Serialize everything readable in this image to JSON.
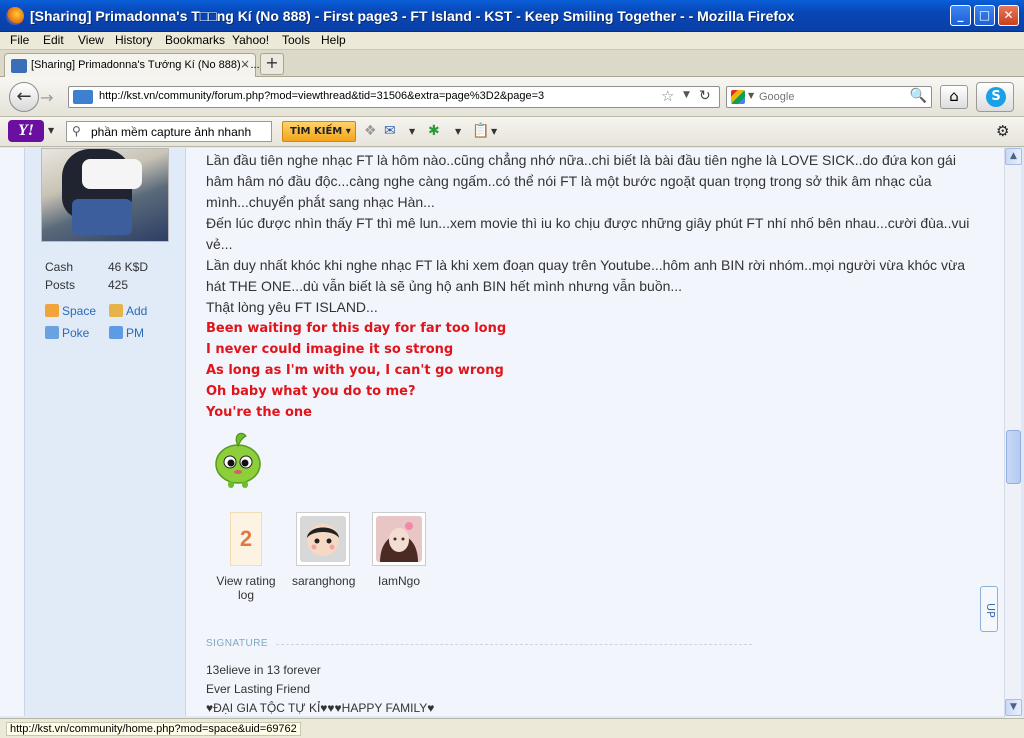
{
  "window": {
    "title": "[Sharing] Primadonna's T□□ng Kí (No 888) - First page3 - FT Island - KST - Keep Smiling Together - - Mozilla Firefox",
    "buttons": {
      "minimize": "_",
      "maximize": "□",
      "close": "✕"
    }
  },
  "menubar": {
    "items": [
      "File",
      "Edit",
      "View",
      "History",
      "Bookmarks",
      "Yahoo!",
      "Tools",
      "Help"
    ]
  },
  "tabs": [
    {
      "label": "[Sharing] Primadonna's Tướng Kí (No 888) - ...",
      "close": "×"
    }
  ],
  "new_tab": "+",
  "nav": {
    "url": "http://kst.vn/community/forum.php?mod=viewthread&tid=31506&extra=page%3D2&page=3",
    "search_placeholder": "Google"
  },
  "yahoo_toolbar": {
    "logo": "Y!",
    "search_query": "phần mềm capture ảnh nhanh",
    "search_button": "TÌM KIẾM ▾"
  },
  "profile": {
    "stats": [
      {
        "label": "Cash",
        "value": "46 K$D"
      },
      {
        "label": "Posts",
        "value": "425"
      }
    ],
    "links": {
      "space": "Space",
      "add": "Add",
      "poke": "Poke",
      "pm": "PM"
    }
  },
  "post": {
    "lines": [
      "Lần đầu tiên nghe nhạc FT là hôm nào..cũng chẳng nhớ nữa..chi biết là bài đầu tiên nghe là LOVE SICK..do đứa kon gái",
      "hâm hâm nó đầu độc...càng nghe càng ngấm..có thể nói FT là một bước ngoặt quan trọng trong sở thik âm nhạc của",
      "mình...chuyển phắt sang nhạc Hàn...",
      "Đến lúc được nhìn thấy FT thì mê lun...xem movie thì iu ko chịu được những giây phút FT nhí nhố bên nhau...cười đùa..vui",
      "vẻ...",
      "Lần duy nhất khóc khi nghe nhạc FT là khi xem đoạn quay trên Youtube...hôm anh BIN rời nhóm..mọi người vừa khóc vừa",
      "hát THE ONE...dù vẫn biết là sẽ ủng hộ anh BIN hết mình nhưng vẫn buồn...",
      "Thật lòng yêu FT ISLAND..."
    ],
    "lyrics": [
      "Been waiting for this day for far too long",
      "I never could imagine it so strong",
      "As long as I'm with you, I can't go wrong",
      "Oh baby what you do to me?",
      "You're the one"
    ],
    "rating": {
      "count": "2",
      "label_line1": "View rating",
      "label_line2": "log"
    },
    "raters": [
      "saranghong",
      "IamNgo"
    ],
    "signature_label": "SIGNATURE",
    "signature_lines": [
      "13elieve in 13 forever",
      "Ever Lasting Friend",
      "♥ĐẠI GIA TỘC TỰ KỈ♥♥♥HAPPY FAMILY♥"
    ]
  },
  "back_to_top": "UP",
  "status": "http://kst.vn/community/home.php?mod=space&uid=69762"
}
